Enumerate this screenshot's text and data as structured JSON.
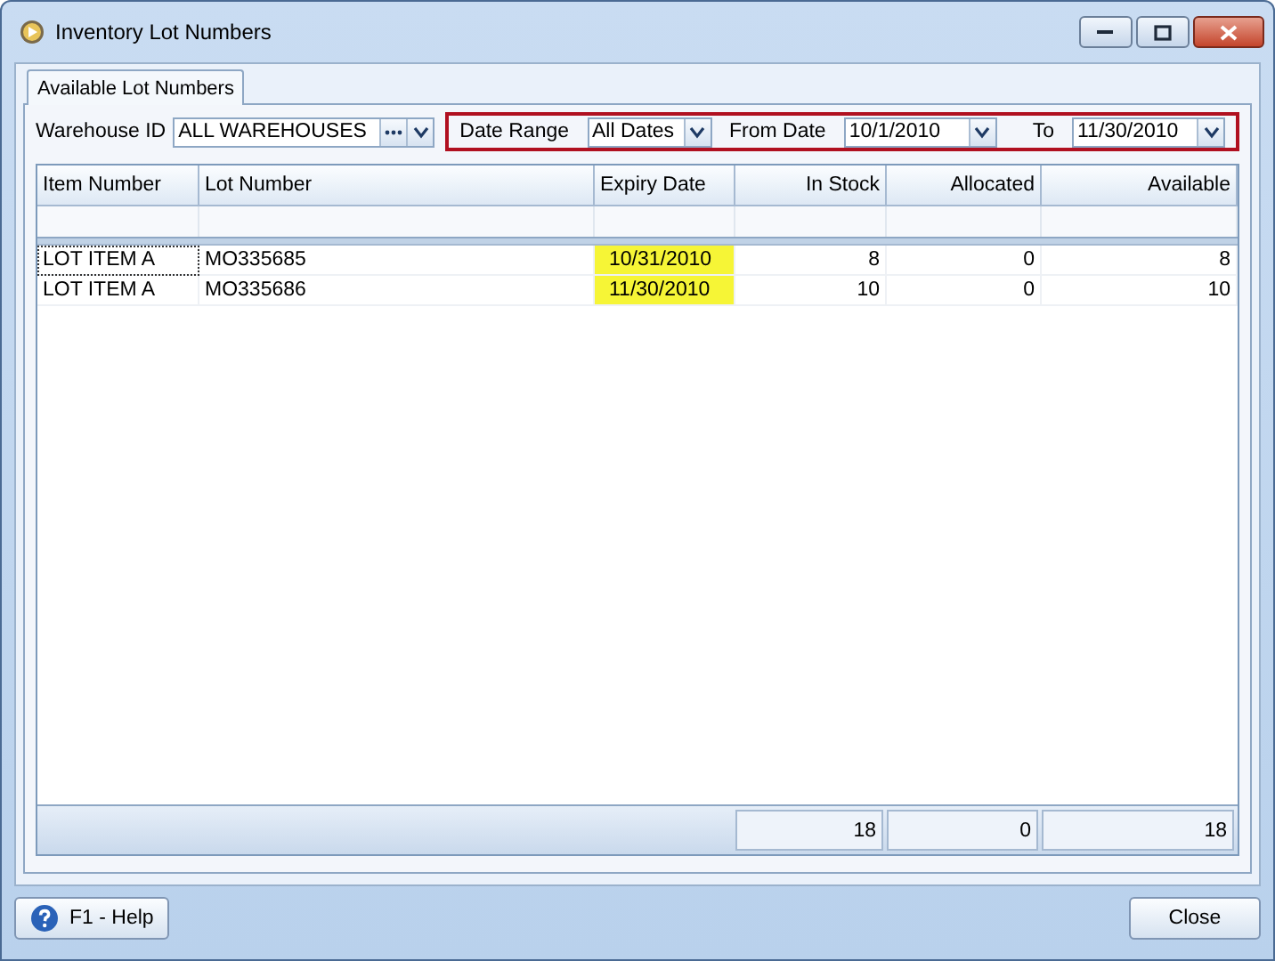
{
  "window": {
    "title": "Inventory Lot Numbers"
  },
  "tabs": [
    {
      "label": "Available Lot Numbers",
      "selected": true
    }
  ],
  "warehouse": {
    "label": "Warehouse ID",
    "value": "ALL WAREHOUSES"
  },
  "date_filters": {
    "outlined": true,
    "date_range": {
      "label": "Date Range",
      "value": "All Dates"
    },
    "from_date": {
      "label": "From Date",
      "value": "10/1/2010"
    },
    "to_date": {
      "label": "To",
      "value": "11/30/2010"
    }
  },
  "table": {
    "columns": [
      {
        "label": "Item Number",
        "kind": "text"
      },
      {
        "label": "Lot Number",
        "kind": "text"
      },
      {
        "label": "Expiry Date",
        "kind": "text"
      },
      {
        "label": "In Stock",
        "kind": "number"
      },
      {
        "label": "Allocated",
        "kind": "number"
      },
      {
        "label": "Available",
        "kind": "number"
      }
    ],
    "rows": [
      {
        "focused": true,
        "expiry_highlighted": true,
        "cells": [
          "LOT ITEM A",
          "MO335685",
          "10/31/2010",
          "8",
          "0",
          "8"
        ]
      },
      {
        "focused": false,
        "expiry_highlighted": true,
        "cells": [
          "LOT ITEM A",
          "MO335686",
          "11/30/2010",
          "10",
          "0",
          "10"
        ]
      }
    ],
    "totals": {
      "in_stock": "18",
      "allocated": "0",
      "available": "18"
    }
  },
  "buttons": {
    "help": "F1 - Help",
    "close": "Close"
  }
}
